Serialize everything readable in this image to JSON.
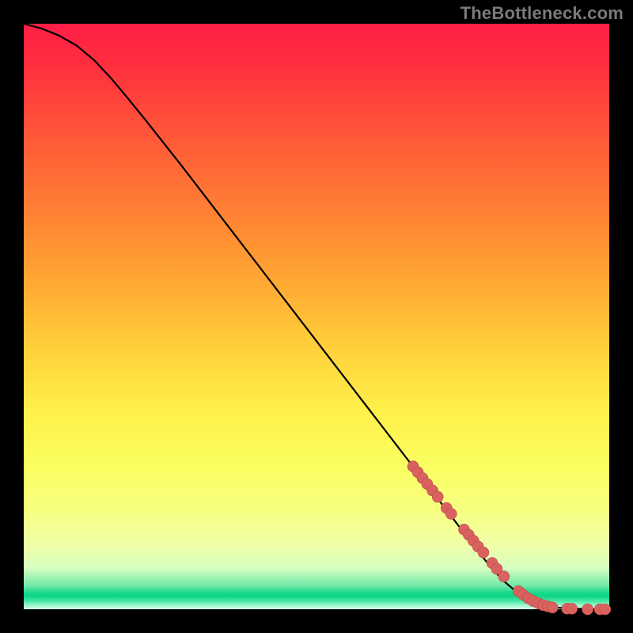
{
  "watermark": "TheBottleneck.com",
  "chart_data": {
    "type": "line",
    "title": "",
    "xlabel": "",
    "ylabel": "",
    "xlim": [
      0,
      100
    ],
    "ylim": [
      0,
      100
    ],
    "grid": false,
    "legend": false,
    "series": [
      {
        "name": "curve",
        "x": [
          0,
          3,
          6,
          9,
          12,
          15,
          18,
          21,
          24,
          27,
          30,
          33,
          36,
          39,
          42,
          45,
          48,
          51,
          54,
          57,
          60,
          63,
          66,
          69,
          72,
          75,
          78,
          80,
          82,
          84,
          86,
          88,
          90,
          92,
          94,
          96,
          98,
          100
        ],
        "y": [
          100,
          99.2,
          98.0,
          96.3,
          93.8,
          90.6,
          87.0,
          83.3,
          79.5,
          75.7,
          71.8,
          67.9,
          64.0,
          60.1,
          56.2,
          52.3,
          48.4,
          44.5,
          40.6,
          36.7,
          32.8,
          28.9,
          25.0,
          21.1,
          17.2,
          13.3,
          9.4,
          6.9,
          4.8,
          3.1,
          1.8,
          0.9,
          0.4,
          0.2,
          0.1,
          0.05,
          0.02,
          0.0
        ]
      }
    ],
    "markers": {
      "name": "scatter-points",
      "x": [
        66.5,
        67.3,
        68.1,
        68.9,
        69.8,
        70.7,
        72.2,
        73.0,
        75.2,
        76.0,
        76.8,
        77.6,
        78.5,
        80.0,
        80.8,
        82.0,
        84.5,
        85.3,
        86.1,
        87.0,
        87.9,
        88.7,
        89.5,
        90.3,
        92.8,
        93.6,
        96.3,
        98.4,
        99.3
      ],
      "y": [
        24.4,
        23.4,
        22.4,
        21.4,
        20.3,
        19.2,
        17.3,
        16.3,
        13.6,
        12.7,
        11.7,
        10.7,
        9.7,
        7.9,
        6.9,
        5.6,
        3.1,
        2.5,
        1.9,
        1.4,
        1.0,
        0.7,
        0.5,
        0.3,
        0.1,
        0.1,
        0.0,
        0.0,
        0.0
      ]
    },
    "gradient_stops": [
      {
        "pos": 0,
        "color": "#ff1f47"
      },
      {
        "pos": 25,
        "color": "#ff6a36"
      },
      {
        "pos": 50,
        "color": "#ffd23b"
      },
      {
        "pos": 75,
        "color": "#faff62"
      },
      {
        "pos": 93,
        "color": "#d6ffc0"
      },
      {
        "pos": 97,
        "color": "#17d88b"
      },
      {
        "pos": 100,
        "color": "#d7fde9"
      }
    ]
  }
}
